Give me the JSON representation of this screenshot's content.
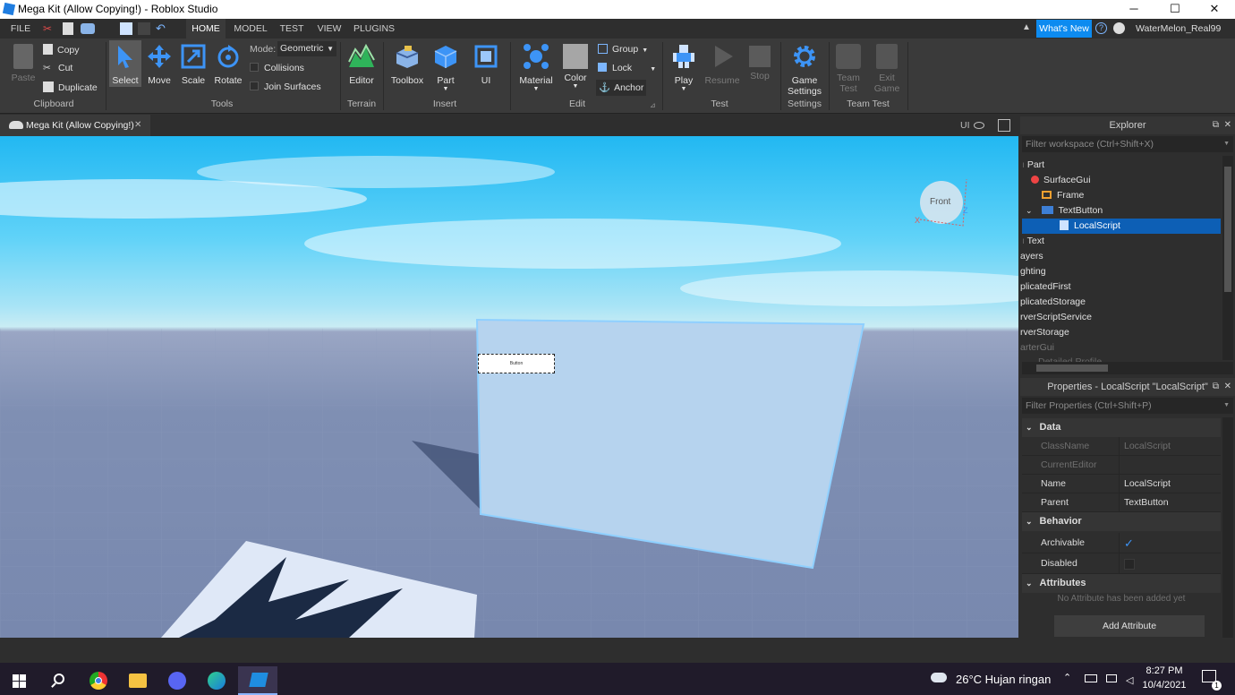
{
  "window": {
    "title": "Mega Kit (Allow Copying!) - Roblox Studio",
    "min": "─",
    "max": "☐",
    "close": "✕"
  },
  "menu": {
    "tabs": [
      "FILE",
      "HOME",
      "MODEL",
      "TEST",
      "VIEW",
      "PLUGINS"
    ],
    "active": "HOME",
    "whats_new": "What's New",
    "user": "WaterMelon_Real99"
  },
  "ribbon": {
    "clipboard": {
      "paste": "Paste",
      "copy": "Copy",
      "cut": "Cut",
      "duplicate": "Duplicate",
      "group": "Clipboard"
    },
    "tools": {
      "select": "Select",
      "move": "Move",
      "scale": "Scale",
      "rotate": "Rotate",
      "mode_label": "Mode:",
      "mode_value": "Geometric",
      "collisions": "Collisions",
      "join_surfaces": "Join Surfaces",
      "group": "Tools"
    },
    "terrain": {
      "editor": "Editor",
      "group": "Terrain"
    },
    "insert": {
      "toolbox": "Toolbox",
      "part": "Part",
      "ui": "UI",
      "group": "Insert"
    },
    "edit": {
      "material": "Material",
      "color": "Color",
      "group_btn": "Group",
      "lock": "Lock",
      "anchor": "Anchor",
      "group": "Edit"
    },
    "test": {
      "play": "Play",
      "resume": "Resume",
      "stop": "Stop",
      "group": "Test"
    },
    "settings": {
      "game": "Game",
      "settings": "Settings",
      "group": "Settings"
    },
    "team_test": {
      "team": "Team",
      "test": "Test",
      "exit": "Exit",
      "game": "Game",
      "group": "Team Test"
    }
  },
  "doc_tab": {
    "label": "Mega Kit (Allow Copying!)",
    "close": "✕",
    "ui_toggle": "UI"
  },
  "viewport": {
    "cube_label": "Front",
    "axis_x": "X",
    "axis_z": "Z",
    "button_text": "Button"
  },
  "explorer": {
    "title": "Explorer",
    "filter": "Filter workspace (Ctrl+Shift+X)",
    "items": [
      "Part",
      "SurfaceGui",
      "Frame",
      "TextButton",
      "LocalScript",
      "Text",
      "ayers",
      "ghting",
      "plicatedFirst",
      "plicatedStorage",
      "rverScriptService",
      "rverStorage",
      "arterGui",
      "Detailed Profile"
    ]
  },
  "properties": {
    "title": "Properties - LocalScript \"LocalScript\"",
    "filter": "Filter Properties (Ctrl+Shift+P)",
    "sections": {
      "data": "Data",
      "behavior": "Behavior",
      "attributes": "Attributes"
    },
    "rows": [
      {
        "key": "ClassName",
        "value": "LocalScript"
      },
      {
        "key": "CurrentEditor",
        "value": ""
      },
      {
        "key": "Name",
        "value": "LocalScript"
      },
      {
        "key": "Parent",
        "value": "TextButton"
      },
      {
        "key": "Archivable",
        "value": "✓"
      },
      {
        "key": "Disabled",
        "value": ""
      }
    ],
    "no_attr": "No Attribute has been added yet",
    "add_attr": "Add Attribute"
  },
  "taskbar": {
    "weather": "26°C  Hujan ringan",
    "time": "8:27 PM",
    "date": "10/4/2021",
    "notif": "1"
  },
  "colors": {
    "accent": "#0d8bf0",
    "selection": "#0d5fb5",
    "sky": "#22b8f2",
    "ground": "#7888ae"
  }
}
